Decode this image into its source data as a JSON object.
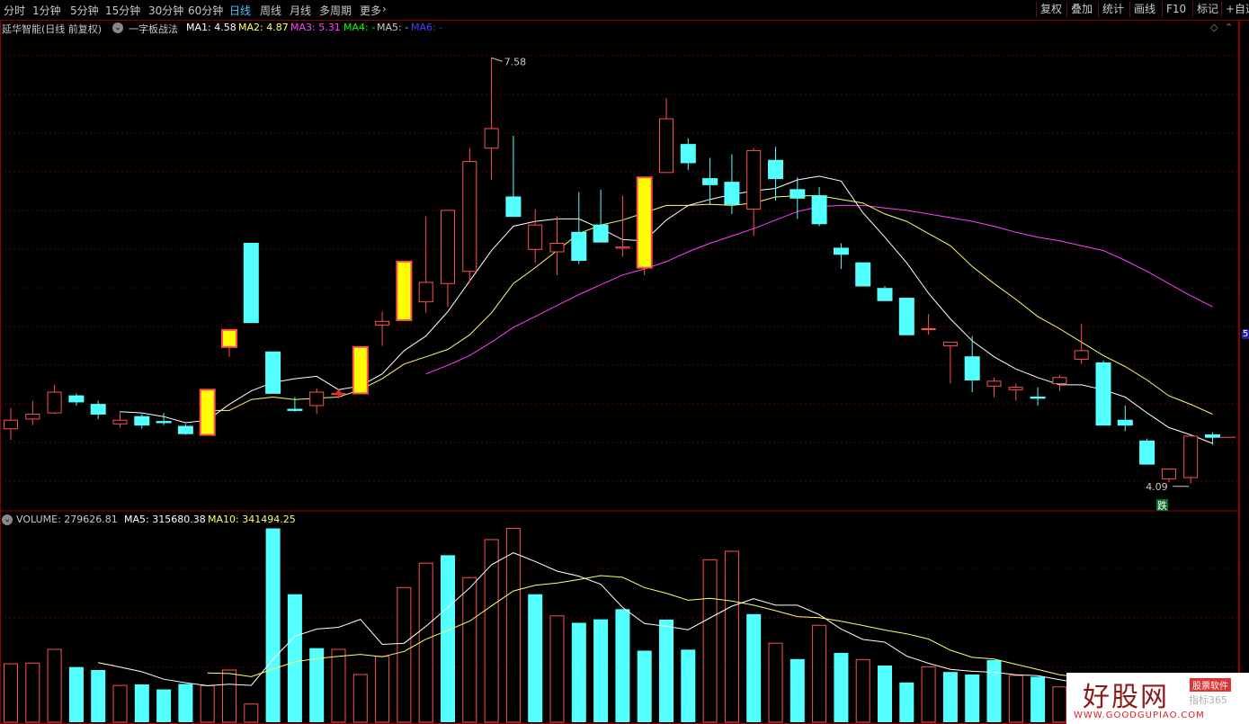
{
  "topbar": {
    "tabs": [
      {
        "label": "分时",
        "active": false
      },
      {
        "label": "1分钟",
        "active": false
      },
      {
        "label": "5分钟",
        "active": false
      },
      {
        "label": "15分钟",
        "active": false
      },
      {
        "label": "30分钟",
        "active": false
      },
      {
        "label": "60分钟",
        "active": false
      },
      {
        "label": "日线",
        "active": true
      },
      {
        "label": "周线",
        "active": false
      },
      {
        "label": "月线",
        "active": false
      },
      {
        "label": "多周期",
        "active": false
      },
      {
        "label": "更多",
        "active": false
      }
    ],
    "more_icon": "chevron-right-icon",
    "tools": [
      "复权",
      "叠加",
      "统计",
      "画线",
      "F10",
      "标记",
      "+自选"
    ]
  },
  "info": {
    "stock_name": "延华智能(日线 前复权)",
    "indicator": "一字板战法",
    "ma1": "MA1: 4.58",
    "ma2": "MA2: 4.87",
    "ma3": "MA3: 5.31",
    "ma4": "MA4: -",
    "ma5": "MA5: -",
    "ma6": "MA6: -"
  },
  "chart_labels": {
    "high": "7.58",
    "low": "4.09",
    "sell_marker": "跌",
    "axis_right": "5"
  },
  "volume_info": {
    "label": "VOLUME: 279626.81",
    "ma5": "MA5: 315680.38",
    "ma10": "MA10: 341494.25"
  },
  "colors": {
    "up": "#ff5050",
    "down": "#54ffff",
    "limit_up_fill": "#ffff00",
    "ma1": "#ffffff",
    "ma2": "#ffff66",
    "ma3": "#ff40ff",
    "ma4": "#00ff00",
    "ma6": "#4040ff",
    "grid": "#5a0000"
  },
  "logo": {
    "title": "好股网",
    "url": "WWW.GOODGUPIAO.COM",
    "badge": "股票软件",
    "sub": "指标365"
  },
  "chart_data": {
    "type": "candlestick",
    "price_axis": {
      "label": "5"
    },
    "annotations": [
      {
        "type": "buy-arrow",
        "x_index": 15
      }
    ],
    "candles": [
      {
        "o": 4.54,
        "h": 4.71,
        "l": 4.45,
        "c": 4.61,
        "limit": false
      },
      {
        "o": 4.62,
        "h": 4.77,
        "l": 4.57,
        "c": 4.66,
        "limit": false
      },
      {
        "o": 4.67,
        "h": 4.9,
        "l": 4.66,
        "c": 4.84,
        "limit": false
      },
      {
        "o": 4.81,
        "h": 4.83,
        "l": 4.73,
        "c": 4.76,
        "limit": false
      },
      {
        "o": 4.74,
        "h": 4.77,
        "l": 4.62,
        "c": 4.66,
        "limit": false
      },
      {
        "o": 4.58,
        "h": 4.68,
        "l": 4.55,
        "c": 4.61,
        "limit": false
      },
      {
        "o": 4.64,
        "h": 4.66,
        "l": 4.54,
        "c": 4.57,
        "limit": false
      },
      {
        "o": 4.6,
        "h": 4.67,
        "l": 4.57,
        "c": 4.59,
        "limit": false
      },
      {
        "o": 4.56,
        "h": 4.58,
        "l": 4.49,
        "c": 4.5,
        "limit": false
      },
      {
        "o": 4.49,
        "h": 4.86,
        "l": 4.49,
        "c": 4.86,
        "limit": true
      },
      {
        "o": 5.21,
        "h": 5.35,
        "l": 5.13,
        "c": 5.35,
        "limit": true
      },
      {
        "o": 6.06,
        "h": 6.06,
        "l": 5.41,
        "c": 5.41,
        "limit": false
      },
      {
        "o": 5.17,
        "h": 5.17,
        "l": 4.83,
        "c": 4.83,
        "limit": false
      },
      {
        "o": 4.7,
        "h": 4.8,
        "l": 4.68,
        "c": 4.69,
        "limit": false
      },
      {
        "o": 4.73,
        "h": 4.87,
        "l": 4.66,
        "c": 4.84,
        "limit": false
      },
      {
        "o": 4.82,
        "h": 4.86,
        "l": 4.79,
        "c": 4.83,
        "limit": false
      },
      {
        "o": 4.83,
        "h": 5.21,
        "l": 4.83,
        "c": 5.21,
        "limit": true
      },
      {
        "o": 5.39,
        "h": 5.5,
        "l": 5.22,
        "c": 5.42,
        "limit": false
      },
      {
        "o": 5.43,
        "h": 5.91,
        "l": 5.43,
        "c": 5.91,
        "limit": true
      },
      {
        "o": 5.58,
        "h": 6.28,
        "l": 5.49,
        "c": 5.74,
        "limit": false
      },
      {
        "o": 5.73,
        "h": 6.28,
        "l": 5.54,
        "c": 6.33,
        "limit": false
      },
      {
        "o": 5.83,
        "h": 6.84,
        "l": 5.74,
        "c": 6.73,
        "limit": false
      },
      {
        "o": 6.84,
        "h": 7.58,
        "l": 6.58,
        "c": 7.0,
        "limit": false
      },
      {
        "o": 6.44,
        "h": 6.94,
        "l": 6.3,
        "c": 6.28,
        "limit": false
      },
      {
        "o": 6.01,
        "h": 6.34,
        "l": 5.9,
        "c": 6.21,
        "limit": false
      },
      {
        "o": 5.99,
        "h": 6.28,
        "l": 5.8,
        "c": 6.06,
        "limit": false
      },
      {
        "o": 6.15,
        "h": 6.48,
        "l": 5.89,
        "c": 5.92,
        "limit": false
      },
      {
        "o": 6.21,
        "h": 6.5,
        "l": 6.07,
        "c": 6.07,
        "limit": false
      },
      {
        "o": 6.02,
        "h": 6.45,
        "l": 5.95,
        "c": 6.03,
        "limit": false
      },
      {
        "o": 5.86,
        "h": 6.4,
        "l": 5.8,
        "c": 6.6,
        "limit": true
      },
      {
        "o": 6.64,
        "h": 7.25,
        "l": 6.64,
        "c": 7.08,
        "limit": false
      },
      {
        "o": 6.87,
        "h": 6.92,
        "l": 6.66,
        "c": 6.72,
        "limit": false
      },
      {
        "o": 6.59,
        "h": 6.76,
        "l": 6.38,
        "c": 6.54,
        "limit": false
      },
      {
        "o": 6.56,
        "h": 6.79,
        "l": 6.3,
        "c": 6.38,
        "limit": false
      },
      {
        "o": 6.34,
        "h": 6.84,
        "l": 6.12,
        "c": 6.82,
        "limit": false
      },
      {
        "o": 6.74,
        "h": 6.85,
        "l": 6.41,
        "c": 6.59,
        "limit": false
      },
      {
        "o": 6.5,
        "h": 6.6,
        "l": 6.26,
        "c": 6.43,
        "limit": false
      },
      {
        "o": 6.45,
        "h": 6.52,
        "l": 6.2,
        "c": 6.22,
        "limit": false
      },
      {
        "o": 6.02,
        "h": 6.06,
        "l": 5.85,
        "c": 5.97,
        "limit": false
      },
      {
        "o": 5.9,
        "h": 5.9,
        "l": 5.71,
        "c": 5.71,
        "limit": false
      },
      {
        "o": 5.69,
        "h": 5.71,
        "l": 5.59,
        "c": 5.59,
        "limit": false
      },
      {
        "o": 5.61,
        "h": 5.61,
        "l": 5.31,
        "c": 5.31,
        "limit": false
      },
      {
        "o": 5.36,
        "h": 5.48,
        "l": 5.31,
        "c": 5.36,
        "limit": false
      },
      {
        "o": 5.22,
        "h": 5.25,
        "l": 4.91,
        "c": 5.25,
        "limit": false
      },
      {
        "o": 5.13,
        "h": 5.3,
        "l": 4.84,
        "c": 4.94,
        "limit": false
      },
      {
        "o": 4.89,
        "h": 4.96,
        "l": 4.8,
        "c": 4.93,
        "limit": false
      },
      {
        "o": 4.86,
        "h": 4.91,
        "l": 4.77,
        "c": 4.88,
        "limit": false
      },
      {
        "o": 4.8,
        "h": 4.88,
        "l": 4.73,
        "c": 4.79,
        "limit": false
      },
      {
        "o": 4.91,
        "h": 4.98,
        "l": 4.85,
        "c": 4.96,
        "limit": false
      },
      {
        "o": 5.11,
        "h": 5.4,
        "l": 5.07,
        "c": 5.18,
        "limit": false
      },
      {
        "o": 5.08,
        "h": 5.1,
        "l": 4.57,
        "c": 4.57,
        "limit": false
      },
      {
        "o": 4.61,
        "h": 4.73,
        "l": 4.52,
        "c": 4.57,
        "limit": false
      },
      {
        "o": 4.44,
        "h": 4.46,
        "l": 4.26,
        "c": 4.25,
        "limit": false
      },
      {
        "o": 4.13,
        "h": 4.19,
        "l": 4.1,
        "c": 4.21,
        "limit": false
      },
      {
        "o": 4.14,
        "h": 4.49,
        "l": 4.09,
        "c": 4.48,
        "limit": false
      },
      {
        "o": 4.49,
        "h": 4.51,
        "l": 4.41,
        "c": 4.47,
        "limit": false
      }
    ],
    "ma_lines": {
      "ma1": [
        null,
        null,
        null,
        null,
        null,
        4.68,
        4.67,
        4.64,
        4.59,
        4.61,
        4.74,
        4.85,
        4.92,
        4.95,
        4.97,
        4.86,
        4.89,
        4.99,
        5.18,
        5.3,
        5.5,
        5.75,
        6.0,
        6.2,
        6.24,
        6.26,
        6.26,
        6.18,
        6.09,
        6.08,
        6.25,
        6.37,
        6.42,
        6.46,
        6.49,
        6.51,
        6.58,
        6.61,
        6.57,
        6.31,
        6.11,
        5.9,
        5.65,
        5.44,
        5.26,
        5.13,
        5.03,
        4.96,
        4.9,
        4.9,
        4.86,
        4.8,
        4.67,
        4.55,
        4.49,
        4.42
      ],
      "ma2": [
        null,
        null,
        null,
        null,
        null,
        null,
        null,
        null,
        null,
        4.69,
        4.69,
        4.78,
        4.8,
        4.78,
        4.79,
        4.8,
        4.86,
        4.95,
        5.07,
        5.13,
        5.19,
        5.31,
        5.49,
        5.73,
        5.86,
        6.0,
        6.14,
        6.21,
        6.25,
        6.31,
        6.37,
        6.37,
        6.38,
        6.37,
        6.39,
        6.44,
        6.45,
        6.45,
        6.42,
        6.39,
        6.3,
        6.24,
        6.14,
        6.04,
        5.87,
        5.73,
        5.6,
        5.46,
        5.36,
        5.25,
        5.14,
        5.05,
        4.94,
        4.81,
        4.74,
        4.66
      ],
      "ma3": [
        null,
        null,
        null,
        null,
        null,
        null,
        null,
        null,
        null,
        null,
        null,
        null,
        null,
        null,
        null,
        null,
        null,
        null,
        null,
        4.99,
        5.06,
        5.14,
        5.25,
        5.37,
        5.46,
        5.55,
        5.64,
        5.72,
        5.8,
        5.85,
        5.91,
        5.99,
        6.06,
        6.12,
        6.18,
        6.25,
        6.32,
        6.36,
        6.37,
        6.37,
        6.35,
        6.33,
        6.3,
        6.27,
        6.24,
        6.2,
        6.15,
        6.11,
        6.08,
        6.04,
        6.0,
        5.92,
        5.83,
        5.73,
        5.63,
        5.54
      ]
    },
    "volume": [
      {
        "v": 235000,
        "up": true
      },
      {
        "v": 238000,
        "up": true
      },
      {
        "v": 293000,
        "up": true
      },
      {
        "v": 222000,
        "up": false
      },
      {
        "v": 210000,
        "up": false
      },
      {
        "v": 148000,
        "up": true
      },
      {
        "v": 152000,
        "up": false
      },
      {
        "v": 132000,
        "up": false
      },
      {
        "v": 154000,
        "up": false
      },
      {
        "v": 147000,
        "up": true
      },
      {
        "v": 210000,
        "up": true
      },
      {
        "v": 73000,
        "up": true
      },
      {
        "v": 780000,
        "up": false
      },
      {
        "v": 515000,
        "up": false
      },
      {
        "v": 298000,
        "up": false
      },
      {
        "v": 293000,
        "up": true
      },
      {
        "v": 192000,
        "up": true
      },
      {
        "v": 265000,
        "up": true
      },
      {
        "v": 542000,
        "up": true
      },
      {
        "v": 640000,
        "up": true
      },
      {
        "v": 672000,
        "up": false
      },
      {
        "v": 582000,
        "up": true
      },
      {
        "v": 735000,
        "up": true
      },
      {
        "v": 780000,
        "up": true
      },
      {
        "v": 515000,
        "up": false
      },
      {
        "v": 428000,
        "up": true
      },
      {
        "v": 400000,
        "up": false
      },
      {
        "v": 414000,
        "up": false
      },
      {
        "v": 455000,
        "up": false
      },
      {
        "v": 288000,
        "up": false
      },
      {
        "v": 413000,
        "up": false
      },
      {
        "v": 292000,
        "up": false
      },
      {
        "v": 654000,
        "up": true
      },
      {
        "v": 688000,
        "up": true
      },
      {
        "v": 435000,
        "up": false
      },
      {
        "v": 318000,
        "up": true
      },
      {
        "v": 254000,
        "up": false
      },
      {
        "v": 390000,
        "up": true
      },
      {
        "v": 279000,
        "up": false
      },
      {
        "v": 252000,
        "up": true
      },
      {
        "v": 228000,
        "up": false
      },
      {
        "v": 160000,
        "up": false
      },
      {
        "v": 223000,
        "up": true
      },
      {
        "v": 202000,
        "up": false
      },
      {
        "v": 192000,
        "up": false
      },
      {
        "v": 250000,
        "up": false
      },
      {
        "v": 188000,
        "up": true
      },
      {
        "v": 183000,
        "up": false
      },
      {
        "v": 142000,
        "up": true
      },
      {
        "v": 112000,
        "up": false
      },
      {
        "v": 84000,
        "up": true
      },
      {
        "v": 162000,
        "up": true
      },
      {
        "v": 100000,
        "up": false
      },
      {
        "v": 96000,
        "up": false
      },
      {
        "v": 78000,
        "up": true
      },
      {
        "v": 52000,
        "up": true
      }
    ],
    "volume_ma5": [
      null,
      null,
      null,
      null,
      240000,
      222000,
      203000,
      173000,
      159000,
      147000,
      153000,
      148000,
      253000,
      346000,
      375000,
      382000,
      414000,
      313000,
      318000,
      386000,
      462000,
      540000,
      634000,
      682000,
      647000,
      608000,
      588000,
      555000,
      462000,
      397000,
      386000,
      372000,
      420000,
      467000,
      497000,
      471000,
      471000,
      433000,
      375000,
      333000,
      322000,
      266000,
      237000,
      213000,
      205000,
      201000,
      191000,
      187000,
      171000,
      156000,
      134000,
      120000,
      112000,
      107000,
      110000,
      98000
    ],
    "volume_ma10": [
      null,
      null,
      null,
      null,
      null,
      null,
      null,
      null,
      null,
      198000,
      196000,
      183000,
      214000,
      243000,
      256000,
      265000,
      273000,
      263000,
      285000,
      334000,
      370000,
      407000,
      468000,
      528000,
      551000,
      560000,
      574000,
      590000,
      583000,
      542000,
      519000,
      491000,
      499000,
      488000,
      471000,
      449000,
      425000,
      421000,
      406000,
      389000,
      371000,
      356000,
      335000,
      290000,
      261000,
      254000,
      233000,
      212000,
      191000,
      180000,
      169000,
      154000,
      146000,
      142000,
      137000,
      128000
    ]
  }
}
